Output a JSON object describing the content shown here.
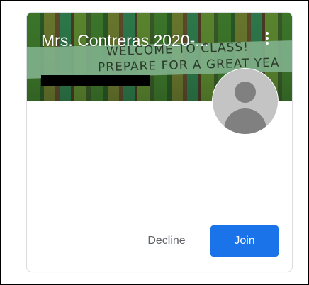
{
  "class_card": {
    "title": "Mrs. Contreras 2020-...",
    "banner_line1": "WELCOME TO CLASS!",
    "banner_line2": "PREPARE FOR A GREAT YEA",
    "menu_icon": "more-vert-icon",
    "avatar_icon": "person-placeholder-icon"
  },
  "actions": {
    "decline_label": "Decline",
    "join_label": "Join"
  },
  "colors": {
    "accent": "#1a73e8",
    "secondary_text": "#5f6368",
    "avatar_bg": "#c4c4c4"
  }
}
